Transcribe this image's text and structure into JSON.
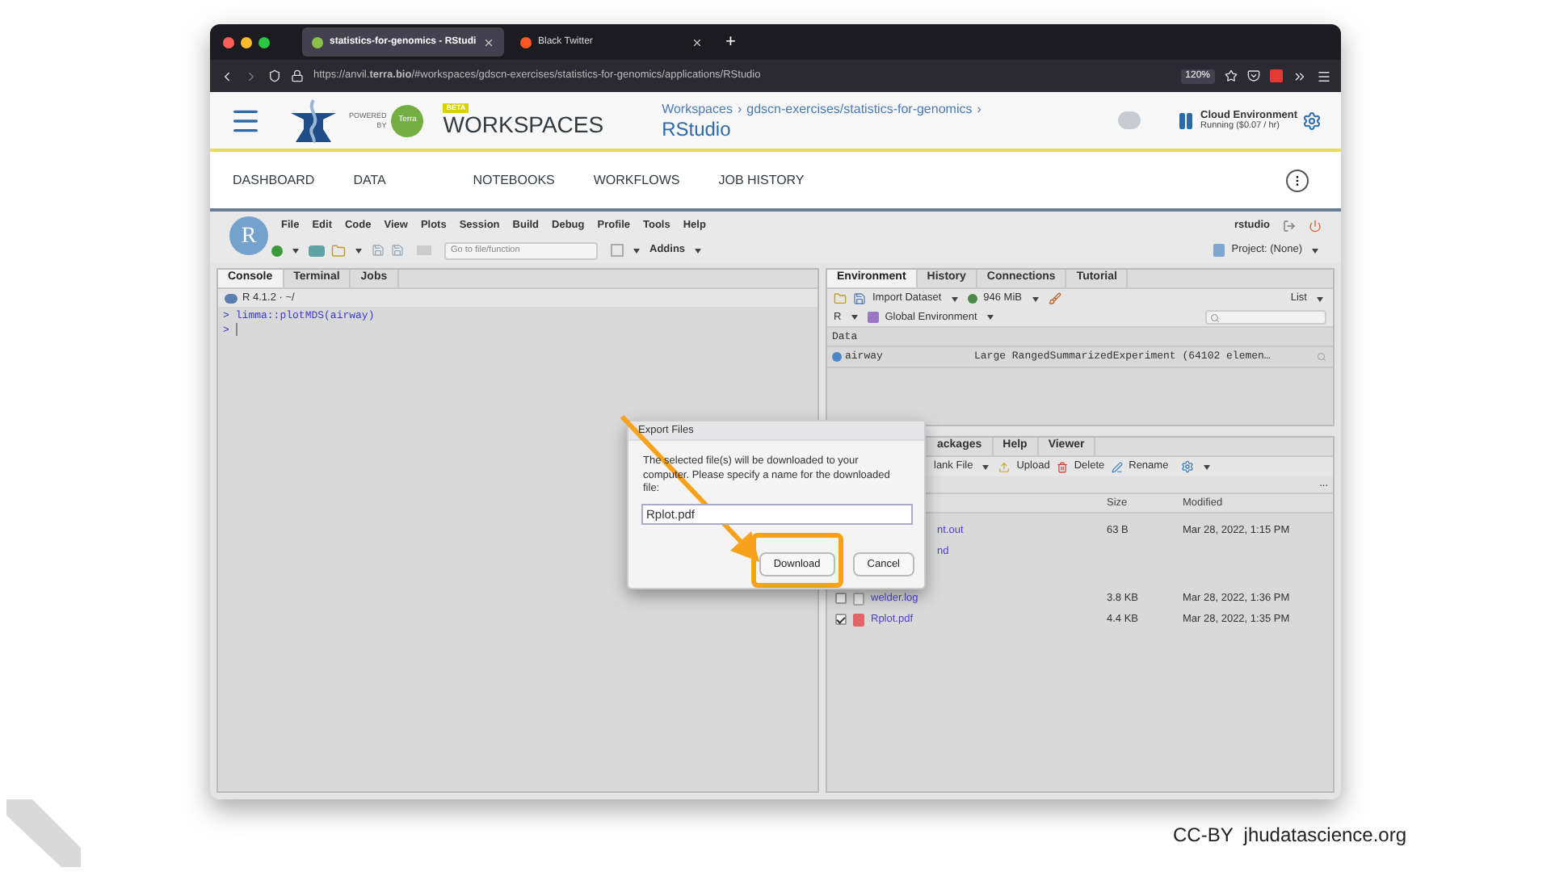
{
  "browser": {
    "tabs": [
      {
        "title": "statistics-for-genomics - RStudi",
        "selected": true
      },
      {
        "title": "Black Twitter",
        "selected": false
      }
    ],
    "new_tab": "+",
    "url": "https://anvil.**terra.bio**/#workspaces/gdscn-exercises/statistics-for-genomics/applications/RStudio",
    "zoom": "120%"
  },
  "terra": {
    "powered": "POWERED",
    "by": "BY",
    "logo": "Terra",
    "badge": "BETA",
    "title": "WORKSPACES",
    "breadcrumb": [
      "Workspaces",
      "gdscn-exercises/statistics-for-genomics"
    ],
    "separator": "›",
    "app": "RStudio",
    "cloud_title": "Cloud Environment",
    "cloud_status": "Running ($0.07 / hr)"
  },
  "nav": [
    "DASHBOARD",
    "DATA",
    "NOTEBOOKS",
    "WORKFLOWS",
    "JOB HISTORY"
  ],
  "rstudio": {
    "logo": "R",
    "menu": [
      "File",
      "Edit",
      "Code",
      "View",
      "Plots",
      "Session",
      "Build",
      "Debug",
      "Profile",
      "Tools",
      "Help"
    ],
    "user": "rstudio",
    "goto_placeholder": "Go to file/function",
    "addins": "Addins",
    "project": "Project: (None)"
  },
  "console": {
    "tabs": [
      {
        "label": "Console",
        "selected": true
      },
      {
        "label": "Terminal",
        "selected": false
      },
      {
        "label": "Jobs",
        "selected": false
      }
    ],
    "version": "R 4.1.2 · ~/",
    "lines": [
      {
        "prompt": ">",
        "code": "limma::plotMDS(airway)"
      },
      {
        "prompt": ">"
      }
    ]
  },
  "environment": {
    "tabs": [
      {
        "label": "Environment",
        "selected": true
      },
      {
        "label": "History",
        "selected": false
      },
      {
        "label": "Connections",
        "selected": false
      },
      {
        "label": "Tutorial",
        "selected": false
      }
    ],
    "import": "Import Dataset",
    "memory": "946 MiB",
    "view": "List",
    "language": "R",
    "scope": "Global Environment",
    "section": "Data",
    "rows": [
      {
        "name": "airway",
        "value": "Large RangedSummarizedExperiment (64102 elemen…"
      }
    ]
  },
  "files": {
    "tabs": [
      {
        "label": "ackages",
        "selected": false
      },
      {
        "label": "Help",
        "selected": false
      },
      {
        "label": "Viewer",
        "selected": false
      }
    ],
    "toolbar": {
      "new": "lank File",
      "upload": "Upload",
      "delete": "Delete",
      "rename": "Rename"
    },
    "more": "...",
    "columns": [
      "Size",
      "Modified"
    ],
    "rows": [
      {
        "kind": "partial",
        "name": "nt.out",
        "size": "63 B",
        "modified": "Mar 28, 2022, 1:15 PM"
      },
      {
        "kind": "partial",
        "name": "nd"
      },
      {
        "kind": "file",
        "name": "welder.log",
        "checked": false,
        "size": "3.8 KB",
        "modified": "Mar 28, 2022, 1:36 PM"
      },
      {
        "kind": "file",
        "name": "Rplot.pdf",
        "checked": true,
        "size": "4.4 KB",
        "modified": "Mar 28, 2022, 1:35 PM"
      }
    ]
  },
  "dialog": {
    "title": "Export Files",
    "message": "The selected file(s) will be downloaded to your computer. Please specify a name for the downloaded file:",
    "value": "Rplot.pdf",
    "buttons": [
      {
        "label": "Download",
        "highlighted": true
      },
      {
        "label": "Cancel",
        "highlighted": false
      }
    ]
  },
  "footer": "CC-BY  jhudatascience.org"
}
